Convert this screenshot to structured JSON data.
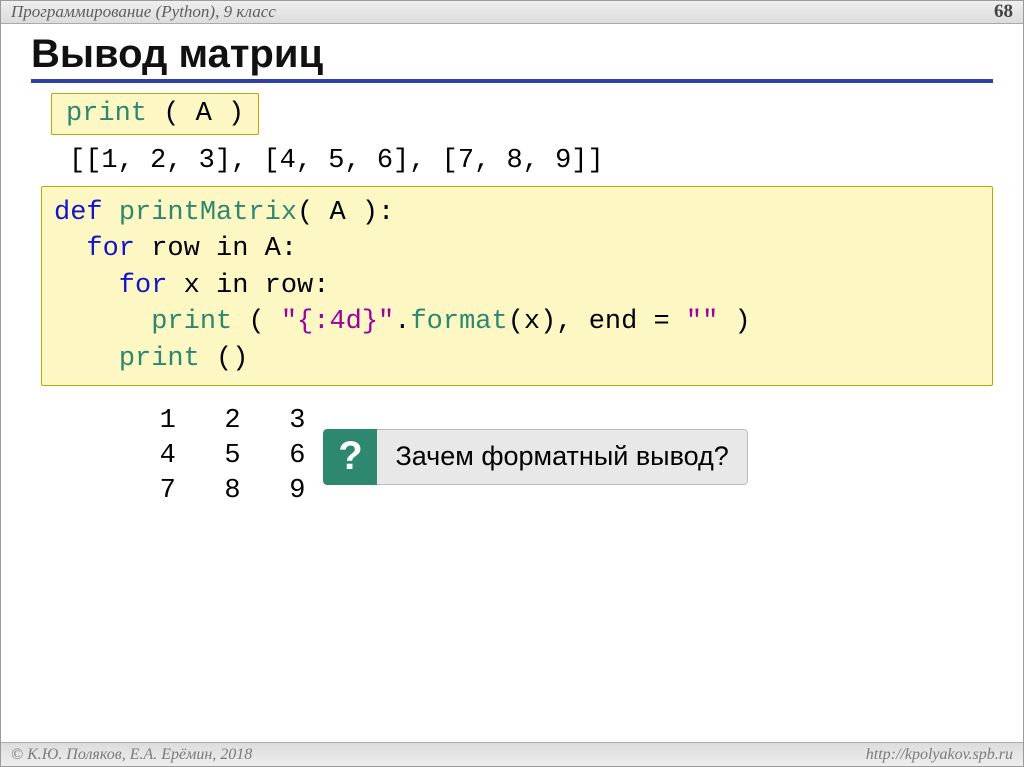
{
  "header": {
    "course": "Программирование (Python), 9 класс",
    "page": "68"
  },
  "title": "Вывод матриц",
  "snippet1": {
    "fn": "print",
    "args": " ( A )"
  },
  "inline_out": "[[1, 2, 3], [4, 5, 6], [7, 8, 9]]",
  "snippet2": {
    "l1_def": "def ",
    "l1_name": "printMatrix",
    "l1_rest": "( A ):",
    "l2_for": "  for ",
    "l2_rest": "row in A:",
    "l3_for": "    for ",
    "l3_rest": "x in row:",
    "l4_pad": "      ",
    "l4_fn": "print",
    "l4_open": " ( ",
    "l4_str": "\"{:4d}\"",
    "l4_dot": ".",
    "l4_fmt": "format",
    "l4_args": "(x), end",
    "l4_eq": " = ",
    "l4_str2": "\"\"",
    "l4_close": " )",
    "l5_pad": "    ",
    "l5_fn": "print",
    "l5_rest": " ()"
  },
  "matrix_out": "   1   2   3\n   4   5   6\n   7   8   9",
  "callout": {
    "mark": "?",
    "text": "Зачем форматный вывод?"
  },
  "footer": {
    "left": "© К.Ю. Поляков, Е.А. Ерёмин, 2018",
    "right": "http://kpolyakov.spb.ru"
  }
}
